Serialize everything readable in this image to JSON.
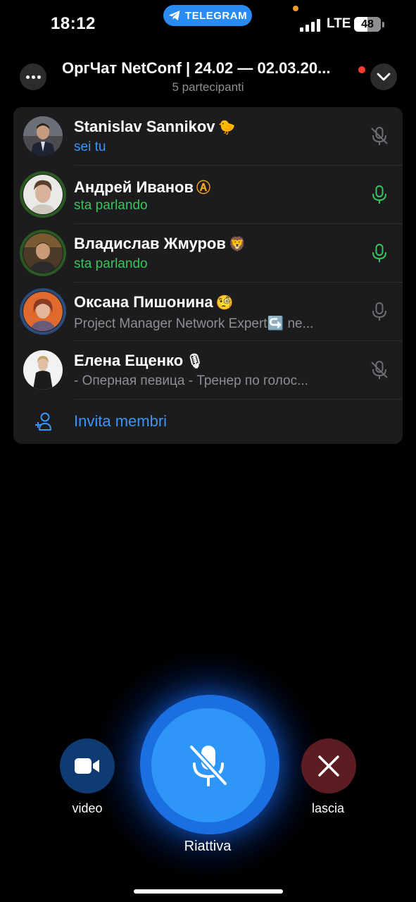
{
  "status_bar": {
    "time": "18:12",
    "app_pill": "TELEGRAM",
    "network": "LTE",
    "battery": "48"
  },
  "header": {
    "title": "ОргЧат NetConf | 24.02 — 02.03.20...",
    "subtitle": "5 partecipanti"
  },
  "participants": [
    {
      "name": "Stanislav Sannikov",
      "emoji": "🐤",
      "status": "sei tu",
      "status_kind": "self",
      "mic": "muted"
    },
    {
      "name": "Андрей Иванов",
      "emoji": "Ⓐ",
      "status": "sta parlando",
      "status_kind": "speaking",
      "mic": "active"
    },
    {
      "name": "Владислав Жмуров",
      "emoji": "🦁",
      "status": "sta parlando",
      "status_kind": "speaking",
      "mic": "active"
    },
    {
      "name": "Оксана Пишонина",
      "emoji": "🧐",
      "status": "Project Manager Network Expert↪️ ne...",
      "status_kind": "bio",
      "mic": "idle"
    },
    {
      "name": "Елена Ещенко",
      "emoji": "🎙",
      "status": "- Оперная певица - Тренер по голос...",
      "status_kind": "bio",
      "mic": "muted"
    }
  ],
  "invite": {
    "label": "Invita membri"
  },
  "controls": {
    "video_label": "video",
    "main_label": "Riattiva",
    "leave_label": "lascia"
  },
  "colors": {
    "accent_blue": "#2d96f7",
    "speaking_green": "#34c759",
    "link_blue": "#3a95f5",
    "leave_red": "#5b1d22",
    "card_bg": "#1c1c1e"
  }
}
